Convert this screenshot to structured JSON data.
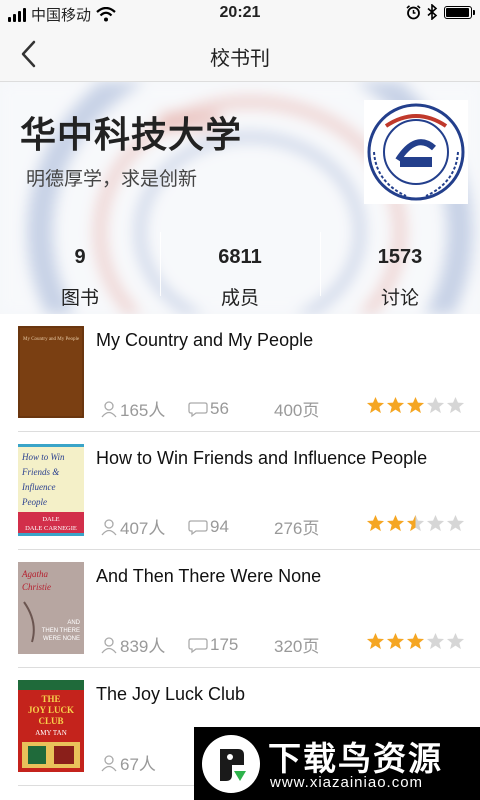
{
  "status_bar": {
    "carrier": "中国移动",
    "time": "20:21",
    "battery_level": 0.95,
    "icons": [
      "signal-icon",
      "wifi-icon",
      "alarm-icon",
      "bluetooth-icon",
      "battery-icon"
    ]
  },
  "nav": {
    "title": "校书刊",
    "back_icon": "back-chevron-icon"
  },
  "header": {
    "name": "华中科技大学",
    "motto": "明德厚学，求是创新",
    "emblem_icon": "university-emblem-icon",
    "stats": [
      {
        "value": "9",
        "label": "图书"
      },
      {
        "value": "6811",
        "label": "成员"
      },
      {
        "value": "1573",
        "label": "讨论"
      }
    ]
  },
  "books": [
    {
      "title": "My Country and My People",
      "readers": "165人",
      "comments": "56",
      "pages": "400页",
      "rating": 3,
      "cover_text": "My Country and My People",
      "cover_color": "#7a3f12"
    },
    {
      "title": "How to Win Friends and Influence People",
      "readers": "407人",
      "comments": "94",
      "pages": "276页",
      "rating": 2.5,
      "cover_text": "How to Win Friends & Influence People",
      "cover_author": "DALE CARNEGIE",
      "cover_color": "#f4f0c8"
    },
    {
      "title": "And Then There Were None",
      "readers": "839人",
      "comments": "175",
      "pages": "320页",
      "rating": 3,
      "cover_text": "Agatha Christie",
      "cover_sub": "AND THEN THERE WERE NONE",
      "cover_color": "#b7a6a1"
    },
    {
      "title": "The Joy Luck Club",
      "readers": "67人",
      "comments": "",
      "pages": "",
      "rating": 0,
      "cover_text": "THE JOY LUCK CLUB",
      "cover_author": "AMY TAN",
      "cover_color": "#c4231c"
    }
  ],
  "watermark": {
    "title": "下载鸟资源",
    "url": "www.xiazainiao.com"
  },
  "colors": {
    "star_on": "#f5a623",
    "star_off": "#d6d6d6",
    "meta_gray": "#999999",
    "nav_bg": "#f7f7f7"
  }
}
